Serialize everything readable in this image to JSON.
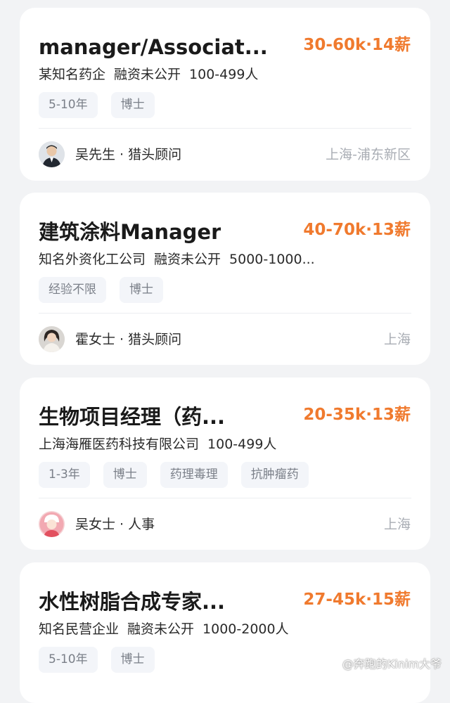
{
  "jobs": [
    {
      "title": "manager/Associat...",
      "salary": "30-60k·14薪",
      "company": {
        "name": "某知名药企",
        "funding": "融资未公开",
        "size": "100-499人"
      },
      "tags": [
        "5-10年",
        "博士"
      ],
      "recruiter": "吴先生 · 猎头顾问",
      "location": "上海-浦东新区"
    },
    {
      "title": "建筑涂料Manager",
      "salary": "40-70k·13薪",
      "company": {
        "name": "知名外资化工公司",
        "funding": "融资未公开",
        "size": "5000-1000..."
      },
      "tags": [
        "经验不限",
        "博士"
      ],
      "recruiter": "霍女士 · 猎头顾问",
      "location": "上海"
    },
    {
      "title": "生物项目经理（药...",
      "salary": "20-35k·13薪",
      "company": {
        "name": "上海海雁医药科技有限公司",
        "funding": "",
        "size": "100-499人"
      },
      "tags": [
        "1-3年",
        "博士",
        "药理毒理",
        "抗肿瘤药"
      ],
      "recruiter": "吴女士 · 人事",
      "location": "上海"
    },
    {
      "title": "水性树脂合成专家...",
      "salary": "27-45k·15薪",
      "company": {
        "name": "知名民营企业",
        "funding": "融资未公开",
        "size": "1000-2000人"
      },
      "tags": [
        "5-10年",
        "博士"
      ],
      "recruiter": "",
      "location": ""
    }
  ],
  "watermark": "@奔跑的Kinim大爷",
  "colors": {
    "salary": "#f07a2e",
    "background": "#f2f3f5",
    "tag_bg": "#f3f5f9"
  }
}
